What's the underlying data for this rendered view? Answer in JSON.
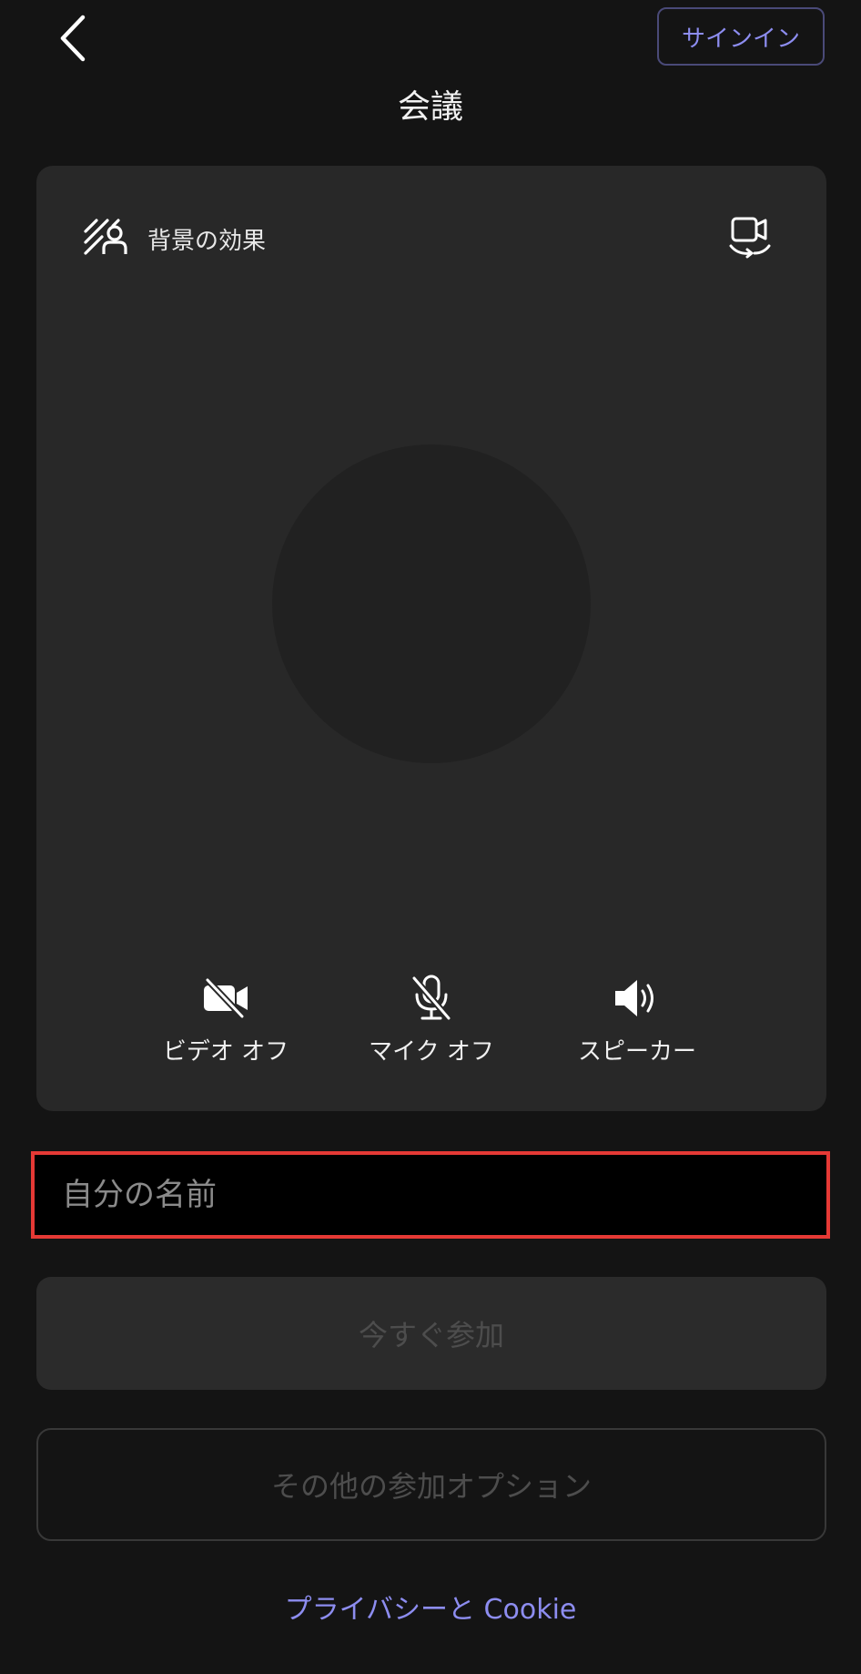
{
  "header": {
    "back_icon": "chevron-left-icon",
    "signin_label": "サインイン",
    "title": "会議"
  },
  "preview": {
    "background_effects_icon": "background-effects-icon",
    "background_effects_label": "背景の効果",
    "switch_camera_icon": "switch-camera-icon",
    "controls": [
      {
        "icon": "video-off-icon",
        "label": "ビデオ オフ"
      },
      {
        "icon": "mic-off-icon",
        "label": "マイク オフ"
      },
      {
        "icon": "speaker-icon",
        "label": "スピーカー"
      }
    ]
  },
  "name_input": {
    "value": "",
    "placeholder": "自分の名前"
  },
  "actions": {
    "join_now_label": "今すぐ参加",
    "other_options_label": "その他の参加オプション"
  },
  "footer": {
    "privacy_label": "プライバシーと Cookie"
  },
  "colors": {
    "background": "#141414",
    "card": "#282828",
    "accent": "#8d8df0",
    "highlight_border": "#e53935"
  }
}
